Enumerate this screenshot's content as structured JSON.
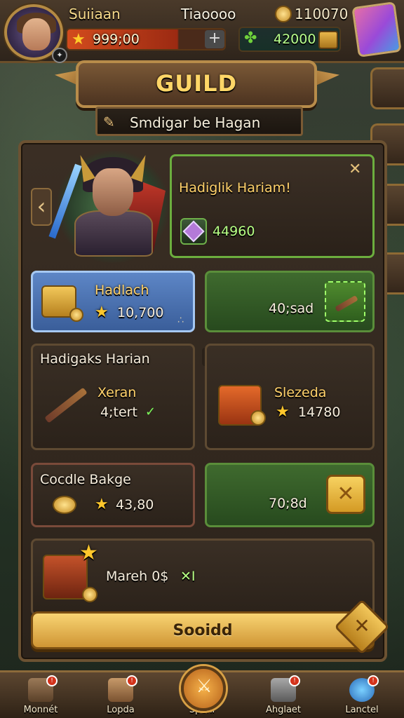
{
  "header": {
    "player_name": "Suiiaan",
    "resource_a": "Tiaoooo",
    "coins": "110070",
    "xp_value": "999;00",
    "gold_value": "42000",
    "xp_plus": "+"
  },
  "guild": {
    "title": "GUILD",
    "subtitle": "Smdigar be Hagan"
  },
  "featured": {
    "title": "Hadiglik Hariam!",
    "reward": "44960"
  },
  "cards": {
    "daily_title": "Hadlach",
    "daily_value": "10,700",
    "daily_dots": "∴",
    "claim_value": "40;sad",
    "section_title": "Hadigaks Harian",
    "weapon_name": "Xeran",
    "weapon_value": "4;tert",
    "chest_name": "Slezeda",
    "chest_value": "14780",
    "bundle_title": "Cocdle Bakge",
    "bundle_value": "43,80",
    "bundle_claim": "70;8d",
    "final_text": "Mareh 0$",
    "final_tag": "✕I"
  },
  "main_button": {
    "label": "Sooidd",
    "x_icon": "✕"
  },
  "nav": [
    {
      "label": "Monnét",
      "badge": "!"
    },
    {
      "label": "Lopda",
      "badge": "!"
    },
    {
      "label": "Spenl",
      "badge": ""
    },
    {
      "label": "Ahglaet",
      "badge": "!"
    },
    {
      "label": "Lanctel",
      "badge": "!"
    }
  ]
}
